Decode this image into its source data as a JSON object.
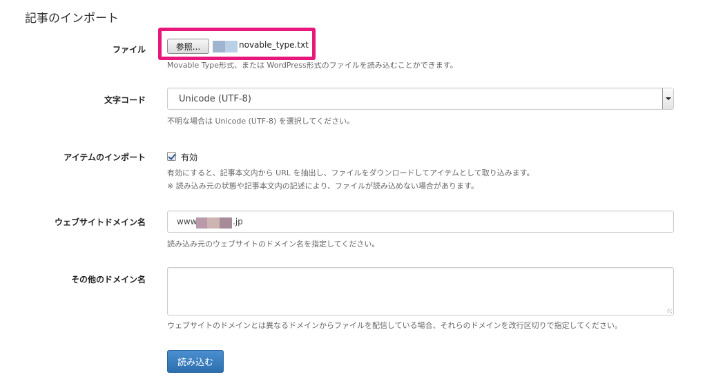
{
  "page": {
    "title": "記事のインポート"
  },
  "file": {
    "label": "ファイル",
    "browse_label": "参照...",
    "file_name": "novable_type.txt",
    "help": "Movable Type形式、または WordPress形式のファイルを読み込むことができます。",
    "highlight_color": "#e8177b"
  },
  "encoding": {
    "label": "文字コード",
    "selected": "Unicode (UTF-8)",
    "help": "不明な場合は Unicode (UTF-8) を選択してください。"
  },
  "item_import": {
    "label": "アイテムのインポート",
    "checkbox_label": "有効",
    "checked": true,
    "help_line1": "有効にすると、記事本文内から URL を抽出し、ファイルをダウンロードしてアイテムとして取り込みます。",
    "help_line2": "※ 読み込み元の状態や記事本文内の記述により、ファイルが読み込めない場合があります。"
  },
  "website_domain": {
    "label": "ウェブサイトドメイン名",
    "value_prefix": "www.",
    "value_suffix": ".jp",
    "help": "読み込み元のウェブサイトのドメイン名を指定してください。"
  },
  "other_domains": {
    "label": "その他のドメイン名",
    "value": "",
    "help": "ウェブサイトのドメインとは異なるドメインからファイルを配信している場合、それらのドメインを改行区切りで指定してください。"
  },
  "submit": {
    "label": "読み込む",
    "color": "#3a7dc0"
  }
}
